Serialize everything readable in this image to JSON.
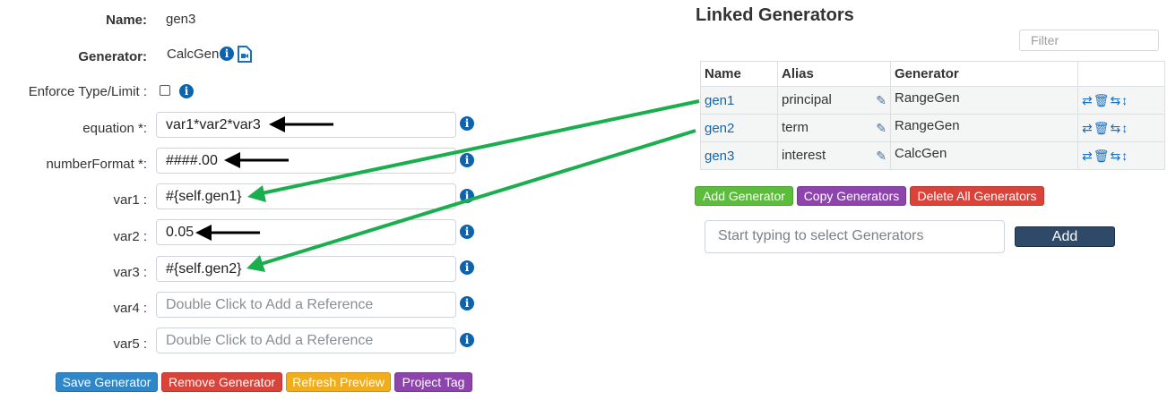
{
  "form": {
    "name_label": "Name:",
    "name_value": "gen3",
    "generator_label": "Generator:",
    "generator_value": "CalcGen",
    "enforce_label": "Enforce Type/Limit :",
    "fields": [
      {
        "label": "equation *:",
        "value": "var1*var2*var3",
        "placeholder": false
      },
      {
        "label": "numberFormat *:",
        "value": "####.00",
        "placeholder": false
      },
      {
        "label": "var1 :",
        "value": "#{self.gen1}",
        "placeholder": false
      },
      {
        "label": "var2 :",
        "value": "0.05",
        "placeholder": false
      },
      {
        "label": "var3 :",
        "value": "#{self.gen2}",
        "placeholder": false
      },
      {
        "label": "var4 :",
        "value": "Double Click to Add a Reference",
        "placeholder": true
      },
      {
        "label": "var5 :",
        "value": "Double Click to Add a Reference",
        "placeholder": true
      }
    ],
    "buttons": {
      "save": "Save Generator",
      "remove": "Remove Generator",
      "refresh": "Refresh Preview",
      "tag": "Project Tag"
    }
  },
  "linked": {
    "title": "Linked Generators",
    "filter_placeholder": "Filter",
    "columns": [
      "Name",
      "Alias",
      "Generator"
    ],
    "rows": [
      {
        "name": "gen1",
        "alias": "principal",
        "generator": "RangeGen"
      },
      {
        "name": "gen2",
        "alias": "term",
        "generator": "RangeGen"
      },
      {
        "name": "gen3",
        "alias": "interest",
        "generator": "CalcGen"
      }
    ],
    "buttons": {
      "add": "Add Generator",
      "copy": "Copy Generators",
      "delete_all": "Delete All Generators"
    },
    "select_placeholder": "Start typing to select Generators",
    "add_label": "Add"
  },
  "colors": {
    "save_button": "#2f86c9",
    "remove_button": "#d9433a",
    "refresh_button": "#f2ad1d",
    "tag_button": "#8e44ad",
    "add_generator_button": "#5cbc3c",
    "copy_button": "#8e44ad",
    "delete_all_button": "#d9433a",
    "annotation_green": "#1aae4f",
    "annotation_black": "#000000"
  },
  "icons": {
    "info": "info-icon",
    "document": "document-icon",
    "edit": "pencil-icon",
    "row_actions": [
      "swap-icon",
      "trash-icon",
      "arrows-horizontal-icon",
      "arrows-vertical-icon"
    ]
  }
}
